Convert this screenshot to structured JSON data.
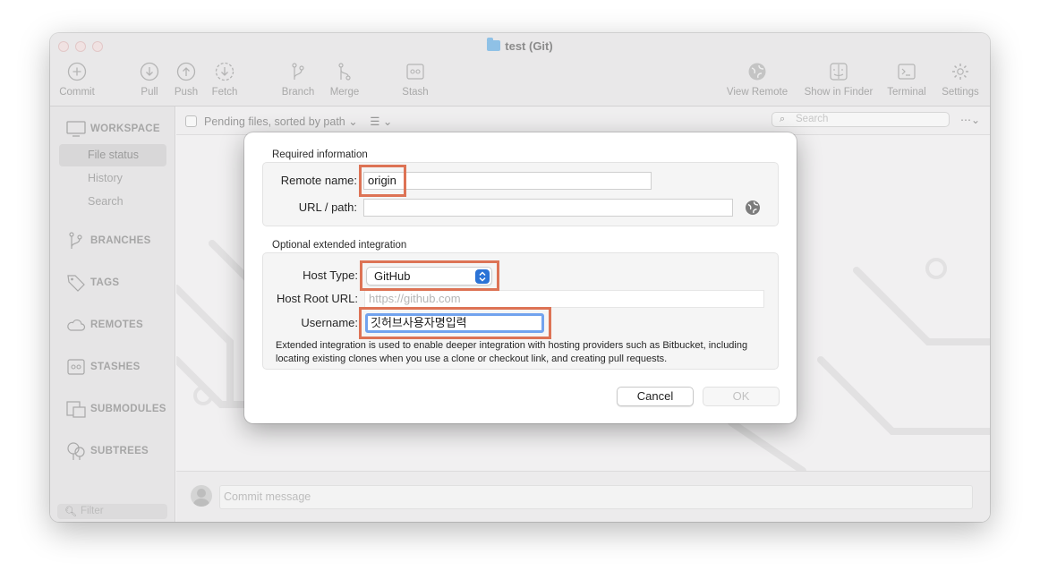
{
  "window": {
    "title": "test (Git)"
  },
  "toolbar": {
    "items": [
      {
        "label": "Commit",
        "icon": "plus-circle-icon"
      },
      {
        "label": "Pull",
        "icon": "arrow-down-circle-icon"
      },
      {
        "label": "Push",
        "icon": "arrow-up-circle-icon"
      },
      {
        "label": "Fetch",
        "icon": "fetch-icon"
      },
      {
        "label": "Branch",
        "icon": "branch-icon"
      },
      {
        "label": "Merge",
        "icon": "merge-icon"
      },
      {
        "label": "Stash",
        "icon": "stash-icon"
      },
      {
        "label": "View Remote",
        "icon": "globe-icon"
      },
      {
        "label": "Show in Finder",
        "icon": "finder-icon"
      },
      {
        "label": "Terminal",
        "icon": "terminal-icon"
      },
      {
        "label": "Settings",
        "icon": "gear-icon"
      }
    ]
  },
  "sidebar": {
    "workspace": {
      "title": "WORKSPACE",
      "items": [
        "File status",
        "History",
        "Search"
      ],
      "active": "File status"
    },
    "sections": [
      "BRANCHES",
      "TAGS",
      "REMOTES",
      "STASHES",
      "SUBMODULES",
      "SUBTREES"
    ],
    "filter_placeholder": "Filter"
  },
  "content": {
    "pending_label": "Pending files, sorted by path",
    "search_placeholder": "Search",
    "commit_placeholder": "Commit message"
  },
  "dialog": {
    "required_title": "Required information",
    "remote_name_label": "Remote name:",
    "remote_name_value": "origin",
    "url_label": "URL / path:",
    "url_value": "",
    "optional_title": "Optional extended integration",
    "host_type_label": "Host Type:",
    "host_type_value": "GitHub",
    "host_root_label": "Host Root URL:",
    "host_root_placeholder": "https://github.com",
    "username_label": "Username:",
    "username_value": "깃허브사용자명입력",
    "hint_text": "Extended integration is used to enable deeper integration with hosting providers such as Bitbucket, including locating existing clones when you use a clone or checkout link, and creating pull requests.",
    "cancel_label": "Cancel",
    "ok_label": "OK"
  },
  "colors": {
    "highlight": "#dd7355",
    "accent": "#2b73d6"
  }
}
